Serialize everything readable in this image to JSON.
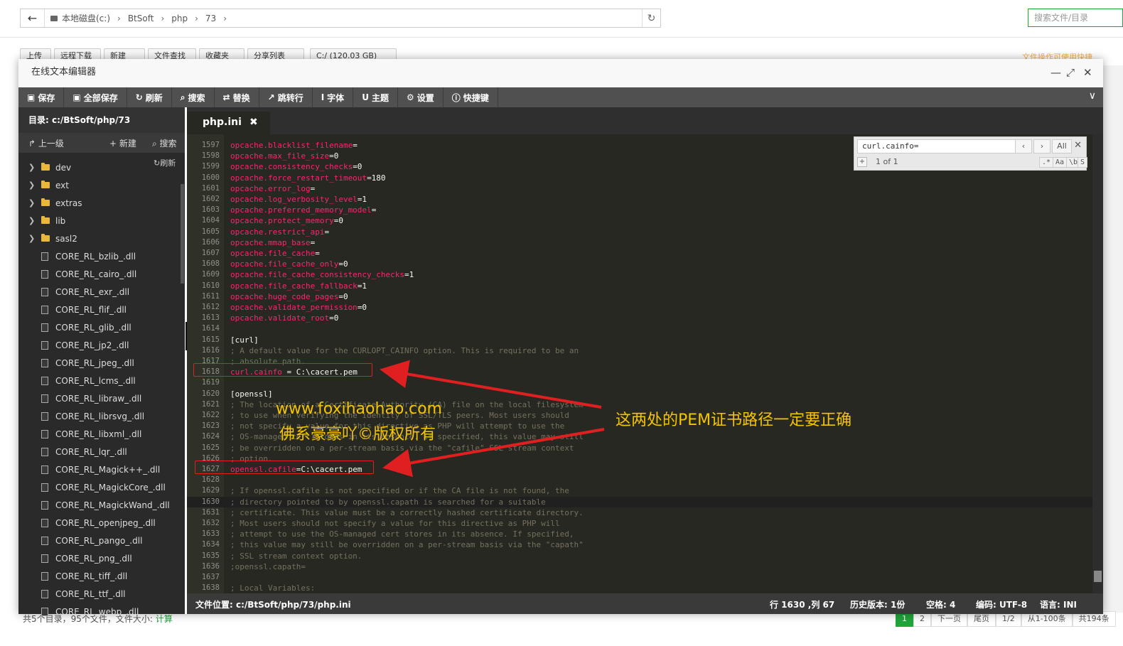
{
  "colors": {
    "accent": "#20a53a",
    "annotation": "#f5c400",
    "arrow": "#e02020",
    "editor_bg": "#272822"
  },
  "file_manager": {
    "back_icon": "arrow-left-icon",
    "breadcrumb": [
      "本地磁盘(c:)",
      "BtSoft",
      "php",
      "73"
    ],
    "search_placeholder": "搜索文件/目录",
    "toolbar": [
      "上传",
      "远程下载",
      "新建",
      "文件查找",
      "收藏夹",
      "分享列表",
      "C:/ (120.03 GB)"
    ],
    "notice": "文件操作可使用快捷",
    "status_prefix": "共5个目录，95个文件，文件大小: ",
    "status_link": "计算",
    "pager": [
      "1",
      "2",
      "下一页",
      "尾页",
      "1/2",
      "从1-100条",
      "共194条"
    ]
  },
  "editor_window": {
    "title": "在线文本编辑器",
    "toolbar": [
      {
        "icon": "save-icon",
        "label": "保存"
      },
      {
        "icon": "save-all-icon",
        "label": "全部保存"
      },
      {
        "icon": "refresh-icon",
        "label": "刷新"
      },
      {
        "icon": "search-icon",
        "label": "搜索"
      },
      {
        "icon": "replace-icon",
        "label": "替换"
      },
      {
        "icon": "goto-icon",
        "label": "跳转行"
      },
      {
        "icon": "font-icon",
        "label": "字体"
      },
      {
        "icon": "theme-icon",
        "label": "主题"
      },
      {
        "icon": "gear-icon",
        "label": "设置"
      },
      {
        "icon": "help-icon",
        "label": "快捷键"
      }
    ],
    "sidebar": {
      "dir_label": "目录: c:/BtSoft/php/73",
      "up": "上一级",
      "new": "新建",
      "search": "搜索",
      "refresh": "刷新",
      "folders": [
        "dev",
        "ext",
        "extras",
        "lib",
        "sasl2"
      ],
      "files": [
        "CORE_RL_bzlib_.dll",
        "CORE_RL_cairo_.dll",
        "CORE_RL_exr_.dll",
        "CORE_RL_flif_.dll",
        "CORE_RL_glib_.dll",
        "CORE_RL_jp2_.dll",
        "CORE_RL_jpeg_.dll",
        "CORE_RL_lcms_.dll",
        "CORE_RL_libraw_.dll",
        "CORE_RL_librsvg_.dll",
        "CORE_RL_libxml_.dll",
        "CORE_RL_lqr_.dll",
        "CORE_RL_Magick++_.dll",
        "CORE_RL_MagickCore_.dll",
        "CORE_RL_MagickWand_.dll",
        "CORE_RL_openjpeg_.dll",
        "CORE_RL_pango_.dll",
        "CORE_RL_png_.dll",
        "CORE_RL_tiff_.dll",
        "CORE_RL_ttf_.dll",
        "CORE_RL_webp_.dll"
      ]
    },
    "tab": "php.ini",
    "search": {
      "query": "curl.cainfo=",
      "all": "All",
      "count": "1 of 1",
      "opts": [
        ".*",
        "Aa",
        "\\b",
        "S"
      ]
    },
    "code_lines": [
      {
        "n": "1597",
        "k": "opcache.blacklist_filename",
        "v": "="
      },
      {
        "n": "1598",
        "k": "opcache.max_file_size",
        "v": "=0"
      },
      {
        "n": "1599",
        "k": "opcache.consistency_checks",
        "v": "=0"
      },
      {
        "n": "1600",
        "k": "opcache.force_restart_timeout",
        "v": "=180"
      },
      {
        "n": "1601",
        "k": "opcache.error_log",
        "v": "="
      },
      {
        "n": "1602",
        "k": "opcache.log_verbosity_level",
        "v": "=1"
      },
      {
        "n": "1603",
        "k": "opcache.preferred_memory_model",
        "v": "="
      },
      {
        "n": "1604",
        "k": "opcache.protect_memory",
        "v": "=0"
      },
      {
        "n": "1605",
        "k": "opcache.restrict_api",
        "v": "="
      },
      {
        "n": "1606",
        "k": "opcache.mmap_base",
        "v": "="
      },
      {
        "n": "1607",
        "k": "opcache.file_cache",
        "v": "="
      },
      {
        "n": "1608",
        "k": "opcache.file_cache_only",
        "v": "=0"
      },
      {
        "n": "1609",
        "k": "opcache.file_cache_consistency_checks",
        "v": "=1"
      },
      {
        "n": "1610",
        "k": "opcache.file_cache_fallback",
        "v": "=1"
      },
      {
        "n": "1611",
        "k": "opcache.huge_code_pages",
        "v": "=0"
      },
      {
        "n": "1612",
        "k": "opcache.validate_permission",
        "v": "=0"
      },
      {
        "n": "1613",
        "k": "opcache.validate_root",
        "v": "=0"
      },
      {
        "n": "1614",
        "t": ""
      },
      {
        "n": "1615",
        "s": "[curl]"
      },
      {
        "n": "1616",
        "c": "; A default value for the CURLOPT_CAINFO option. This is required to be an"
      },
      {
        "n": "1617",
        "c": "; absolute path."
      },
      {
        "n": "1618",
        "k": "curl.cainfo",
        "v": " = C:\\cacert.pem"
      },
      {
        "n": "1619",
        "t": ""
      },
      {
        "n": "1620",
        "s": "[openssl]"
      },
      {
        "n": "1621",
        "c": "; The location of a Certificate Authority (CA) file on the local filesystem"
      },
      {
        "n": "1622",
        "c": "; to use when verifying the identity of SSL/TLS peers. Most users should"
      },
      {
        "n": "1623",
        "c": "; not specify a value for this directive as PHP will attempt to use the"
      },
      {
        "n": "1624",
        "c": "; OS-managed cert stores in its absence. If specified, this value may still"
      },
      {
        "n": "1625",
        "c": "; be overridden on a per-stream basis via the \"cafile\" SSL stream context"
      },
      {
        "n": "1626",
        "c": "; option."
      },
      {
        "n": "1627",
        "k": "openssl.cafile",
        "v": "=C:\\cacert.pem"
      },
      {
        "n": "1628",
        "t": ""
      },
      {
        "n": "1629",
        "c": "; If openssl.cafile is not specified or if the CA file is not found, the"
      },
      {
        "n": "1630",
        "c": "; directory pointed to by openssl.capath is searched for a suitable"
      },
      {
        "n": "1631",
        "c": "; certificate. This value must be a correctly hashed certificate directory."
      },
      {
        "n": "1632",
        "c": "; Most users should not specify a value for this directive as PHP will"
      },
      {
        "n": "1633",
        "c": "; attempt to use the OS-managed cert stores in its absence. If specified,"
      },
      {
        "n": "1634",
        "c": "; this value may still be overridden on a per-stream basis via the \"capath\""
      },
      {
        "n": "1635",
        "c": "; SSL stream context option."
      },
      {
        "n": "1636",
        "c": ";openssl.capath="
      },
      {
        "n": "1637",
        "t": ""
      },
      {
        "n": "1638",
        "c": "; Local Variables:"
      }
    ],
    "statusbar": {
      "path": "文件位置: c:/BtSoft/php/73/php.ini",
      "cursor": "行 1630 ,列 67",
      "history": "历史版本: 1份",
      "indent": "空格: 4",
      "encoding": "编码: UTF-8",
      "language": "语言: INI"
    }
  },
  "watermark": {
    "line1": "www.foxihaohao.com",
    "line2": "佛系豪豪吖©版权所有"
  },
  "annotation": "这两处的PEM证书路径一定要正确"
}
